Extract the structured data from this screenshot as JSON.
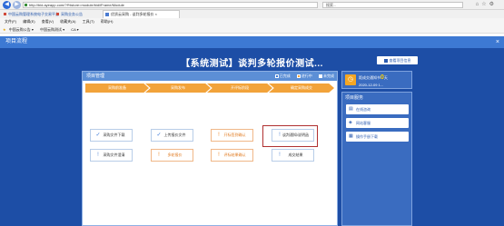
{
  "browser": {
    "address": "http://bid.ayeapp.com/?f%store=module/bid/iFrame/Module",
    "search_placeholder": "搜索...",
    "active_tab": "优质云采购 - 谈判多轮报价 ×",
    "tab_other_1": "中国云购管理系统电子交易平台",
    "tab_other_2": "采购业务公告",
    "menu": [
      "文件(F)",
      "编辑(E)",
      "查看(V)",
      "收藏夹(A)",
      "工具(T)",
      "帮助(H)"
    ],
    "favorites": [
      "中国云购公告 ▾",
      "中国云购测试 ▾",
      "CA ▾"
    ]
  },
  "dialog": {
    "title": "项目流程",
    "close": "×"
  },
  "main": {
    "title": "【系统测试】谈判多轮报价测试...",
    "manage_button": "查看项目信息"
  },
  "project": {
    "header": "项目管理",
    "legend": [
      "已完成",
      "进行中",
      "未完成"
    ],
    "steps": [
      "采购前准备",
      "采购发布",
      "开评标阶段",
      "确定采购成交"
    ],
    "cards_row1": [
      {
        "label": "采购文件下载",
        "icon": "✓",
        "state": "done"
      },
      {
        "label": "上传报价文件",
        "icon": "✓",
        "state": "done"
      },
      {
        "label": "开标签到确认",
        "icon": "!",
        "state": "warn"
      },
      {
        "label": "谈判通知/说明函",
        "icon": "!",
        "state": "pend"
      }
    ],
    "cards_row2": [
      {
        "label": "采购文件澄清",
        "icon": "!",
        "state": "pend"
      },
      {
        "label": "多轮报价",
        "icon": "!",
        "state": "warn"
      },
      {
        "label": "评标结果确认",
        "icon": "!",
        "state": "warn"
      },
      {
        "label": "成交结果",
        "icon": "!",
        "state": "pend"
      }
    ]
  },
  "notice": {
    "prefix": "距成交通知书",
    "count": "0",
    "suffix": "天",
    "date": "2020-12-09 1..."
  },
  "services": {
    "header": "项目服务",
    "items": [
      "在线咨询",
      "网站客服",
      "操作手册下载"
    ]
  }
}
